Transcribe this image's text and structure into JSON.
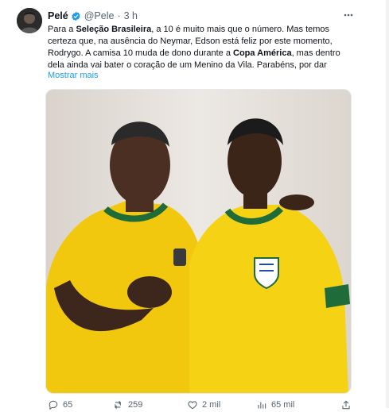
{
  "tweet": {
    "author_name": "Pelé",
    "handle": "@Pele",
    "separator": "·",
    "time": "3 h",
    "text_parts": [
      "Para a ",
      "Seleção Brasileira",
      ", a 10 é muito mais que o número. Mas temos certeza que, na ausência do Neymar, Edson está feliz por este momento, Rodrygo. A camisa 10 muda de dono durante a ",
      "Copa América",
      ", mas dentro dela ainda vai bater o coração de um Menino da Vila. Parabéns, por dar"
    ],
    "show_more": "Mostrar mais",
    "actions": {
      "replies": "65",
      "retweets": "259",
      "likes": "2 mil",
      "views": "65 mil"
    }
  },
  "icons": {
    "verified": "verified-badge-icon",
    "more": "more-options-icon",
    "reply": "reply-icon",
    "retweet": "retweet-icon",
    "like": "heart-icon",
    "views": "views-chart-icon",
    "share": "share-icon"
  },
  "colors": {
    "accent": "#1d9bf0",
    "secondary_text": "#536471",
    "jersey_yellow": "#f2c80f",
    "jersey_green": "#1f6b3a"
  }
}
